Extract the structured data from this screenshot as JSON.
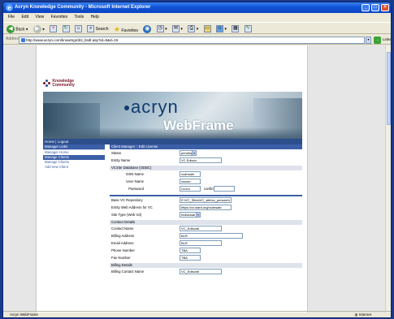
{
  "window": {
    "title": "Acryn Knowledge Community - Microsoft Internet Explorer"
  },
  "menu": [
    "File",
    "Edit",
    "View",
    "Favorites",
    "Tools",
    "Help"
  ],
  "toolbar": {
    "back": "Back",
    "search": "Search",
    "favorites": "Favorites"
  },
  "address": {
    "label": "Address",
    "url": "http://www.acryn.com/knowmgr/dnl_bsdt.asp?id=5&d=15",
    "go": "Go",
    "links": "Links"
  },
  "status": {
    "left": "Acryn WebFrame",
    "zone": "Internet"
  },
  "page": {
    "logo": [
      "Knowledge",
      "Community"
    ],
    "brand": "acryn",
    "product": "WebFrame",
    "home_bar": "Home | Logout",
    "sidebar": [
      "Manager Links",
      "Manager Home",
      "Manage Clients",
      "Manage Clients",
      "Add new Client"
    ],
    "sidebar_active": [
      0,
      2
    ],
    "sections": {
      "header": "Client Manager :: Edit License",
      "status_label": "Status",
      "status_value": "pending",
      "entity_label": "Entity Name",
      "entity_value": "VC Edison",
      "db_header": "VCSite Database (ODBC)",
      "dsn_label": "DSN Name",
      "dsn_value": "vcdnsaib",
      "user_label": "User Name",
      "user_value": "vcuser",
      "pass_label": "Password",
      "pass_value": "••••••••",
      "confirm_label": "confirm",
      "base_label": "Base VC Repository",
      "base_value": "E:\\VC_Sites\\VC_site\\vc_personrb",
      "web_label": "Entity Web Address for VC",
      "web_value": "https://vc.siard.org/vcdnsaib",
      "type_label": "Site Type (Web Vd)",
      "type_value": "Individual",
      "contact_header": "Contact Details",
      "contact_name_label": "Contact Name",
      "contact_name_value": "VC_Edisonb",
      "billing_addr_label": "Billing Address",
      "billing_addr_value": "BLR",
      "email_label": "Email Address",
      "email_value": "BLR",
      "phone_label": "Phone Number",
      "phone_value": "TBA",
      "fax_label": "Fax Number",
      "fax_value": "TBA",
      "billing_header": "Billing Details",
      "billing_contact_label": "Billing Contact Name",
      "billing_contact_value": "VC_Edisonb"
    }
  }
}
